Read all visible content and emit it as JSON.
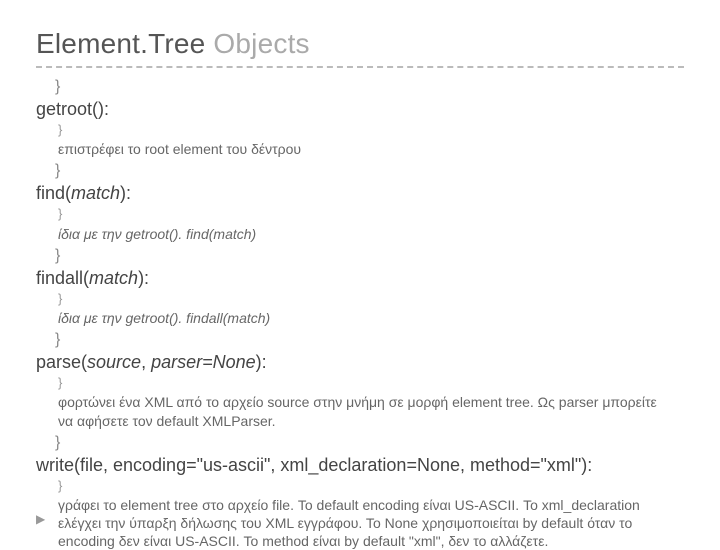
{
  "title_part1": "Element.Tree ",
  "title_part2": "Objects",
  "items": [
    {
      "method": "getroot():",
      "desc": "επιστρέφει το root element του δέντρου"
    },
    {
      "method": "find(match):",
      "method_pre": "find(",
      "method_param": "match",
      "method_post": "):",
      "desc": "ίδια με την getroot(). find(match)",
      "desc_ital": true
    },
    {
      "method": "findall(match):",
      "method_pre": "findall(",
      "method_param": "match",
      "method_post": "):",
      "desc": "ίδια με την getroot(). findall(match)",
      "desc_ital": true
    },
    {
      "method": "parse(source, parser=None):",
      "method_pre": "parse(",
      "method_param": "source",
      "method_mid": ", ",
      "method_param2": "parser=None",
      "method_post": "):",
      "desc": "φορτώνει ένα XML από το αρχείο source στην μνήμη σε μορφή element tree. Ως parser μπορείτε να αφήσετε τον default XMLParser."
    },
    {
      "method": "write(file, encoding=\"us-ascii\", xml_declaration=None, method=\"xml\"):",
      "desc": "γράφει το element tree στο αρχείο file.  Το default encoding είναι US-ASCII. Το xml_declaration ελέγχει την ύπαρξη δήλωσης του XML εγγράφου. Το None χρησιμοποιείται by default όταν το encoding δεν είναι US-ASCII.  Το method είναι by default \"xml\", δεν το αλλάζετε."
    }
  ],
  "bullet": "}",
  "marker": "▶"
}
